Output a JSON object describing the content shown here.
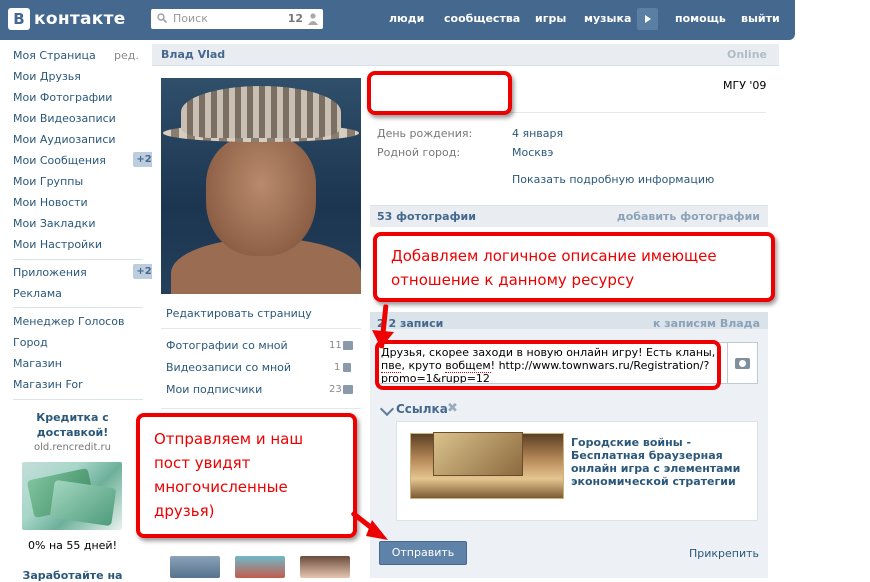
{
  "header": {
    "logo_letter": "В",
    "logo_text": "контакте",
    "search_placeholder": "Поиск",
    "search_count": "12",
    "nav": [
      "люди",
      "сообщества",
      "игры",
      "музыка",
      "помощь",
      "выйти"
    ]
  },
  "sidebar": {
    "items": [
      {
        "label": "Моя Страница",
        "edit": "ред."
      },
      {
        "label": "Мои Друзья"
      },
      {
        "label": "Мои Фотографии"
      },
      {
        "label": "Мои Видеозаписи"
      },
      {
        "label": "Мои Аудиозаписи"
      },
      {
        "label": "Мои Сообщения",
        "badge": "+2"
      },
      {
        "label": "Мои Группы"
      },
      {
        "label": "Мои Новости"
      },
      {
        "label": "Мои Закладки"
      },
      {
        "label": "Мои Настройки"
      }
    ],
    "items2": [
      {
        "label": "Приложения",
        "badge": "+2"
      },
      {
        "label": "Реклама"
      }
    ],
    "items3": [
      {
        "label": "Менеджер Голосов"
      },
      {
        "label": "Город"
      },
      {
        "label": "Магазин"
      },
      {
        "label": "Магазин For"
      }
    ]
  },
  "ad": {
    "title": "Кредитка с доставкой!",
    "domain": "old.rencredit.ru",
    "text": "0% на 55 дней!",
    "more": "Заработайте на"
  },
  "profile": {
    "name": "Влад Vlad",
    "status": "Online",
    "university": "МГУ '09",
    "info": [
      {
        "label": "День рождения:",
        "value": "4 января"
      },
      {
        "label": "Родной город:",
        "value": "Москвэ"
      }
    ],
    "show_more": "Показать подробную информацию",
    "edit_page": "Редактировать страницу",
    "left_links": [
      {
        "label": "Фотографии со мной",
        "count": "11"
      },
      {
        "label": "Видеозаписи со мной",
        "count": "1"
      },
      {
        "label": "Мои подписчики",
        "count": "23"
      }
    ]
  },
  "photos": {
    "header": "53 фотографии",
    "add": "добавить фотографии"
  },
  "wall": {
    "header": "2 2 записи",
    "to_wall": "к записям Влада",
    "post_text_1": "Друзья, скорее заходи в новую онлайн игру! Есть кланы, ",
    "post_text_pve": "пве",
    "post_text_2": ", круто ",
    "post_text_vobshe": "вобщем",
    "post_text_3": "! http://www.townwars.ru/Registration/?promo=1&rupp=12",
    "link_label": "Ссылка",
    "link_title": "Городские войны - Бесплатная браузерная онлайн игра с элементами экономической стратегии",
    "send": "Отправить",
    "attach": "Прикрепить"
  },
  "annotations": {
    "top": "Добавляем логичное описание имеющее отношение к данному ресурсу",
    "bottom": "Отправляем и наш пост увидят многочисленные друзья)"
  },
  "colors": {
    "header_bg": "#45688e",
    "link": "#2b587a",
    "annotation_red": "#e00000"
  }
}
